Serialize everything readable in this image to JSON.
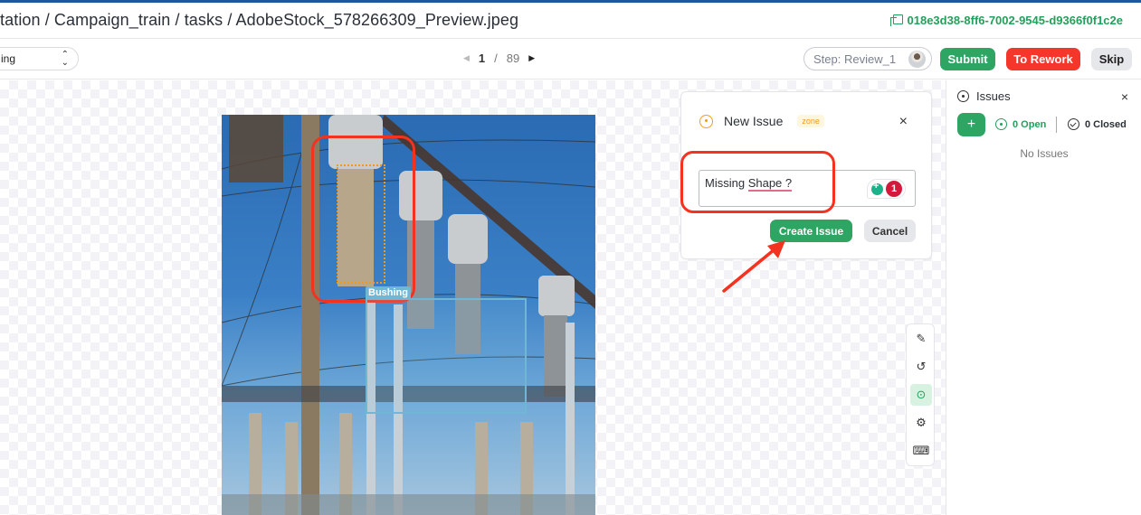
{
  "header": {
    "breadcrumb": "tation / Campaign_train / tasks / AdobeStock_578266309_Preview.jpeg",
    "task_id": "018e3d38-8ff6-7002-9545-d9366f0f1c2e",
    "task_id_icon": "copy-icon"
  },
  "toolbar": {
    "mode_select_value": "ing",
    "pager": {
      "current": "1",
      "separator": "/",
      "total": "89"
    },
    "step_label": "Step: Review_1",
    "submit_label": "Submit",
    "rework_label": "To Rework",
    "skip_label": "Skip"
  },
  "canvas": {
    "annotation_label": "Bushing"
  },
  "new_issue": {
    "title": "New Issue",
    "badge": "zone",
    "close_label": "×",
    "input_text_plain": "Missing ",
    "input_text_underlined": "Shape ?",
    "grammar_count": "1",
    "create_label": "Create Issue",
    "cancel_label": "Cancel"
  },
  "side_tools": [
    {
      "name": "edit-icon",
      "glyph": "✎"
    },
    {
      "name": "history-icon",
      "glyph": "↺"
    },
    {
      "name": "issues-icon",
      "glyph": "⊙",
      "active": true
    },
    {
      "name": "settings-icon",
      "glyph": "⚙"
    },
    {
      "name": "keyboard-icon",
      "glyph": "⌨"
    }
  ],
  "issues_panel": {
    "title": "Issues",
    "close_label": "×",
    "add_label": "+",
    "open_label": "0 Open",
    "closed_label": "0 Closed",
    "empty_label": "No Issues"
  },
  "colors": {
    "accent_green": "#2fa564",
    "rework_red": "#f5362b",
    "header_accent": "#1e56a0",
    "issue_orange": "#f29a1c"
  }
}
